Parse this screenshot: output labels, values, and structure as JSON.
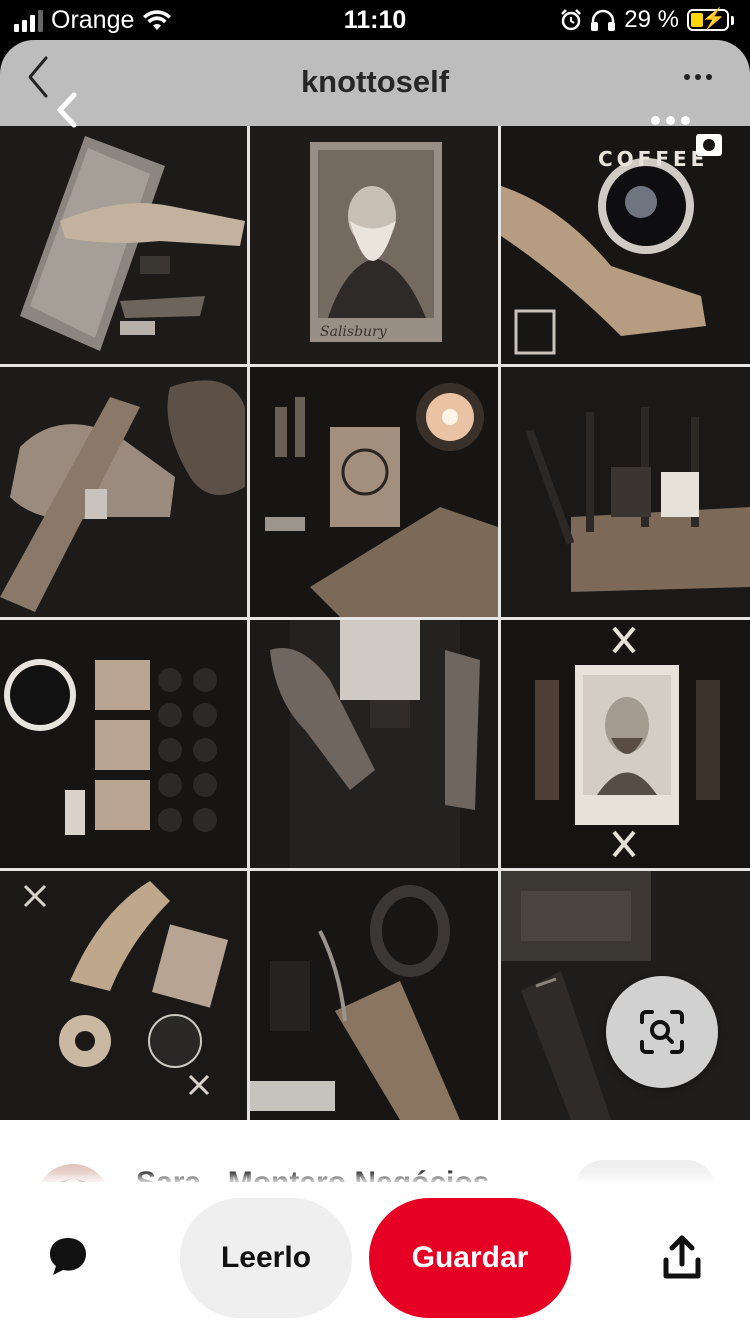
{
  "status_bar": {
    "carrier": "Orange",
    "time": "11:10",
    "battery_percent": "29 %",
    "icons": [
      "signal-icon",
      "wifi-icon",
      "alarm-icon",
      "headphones-icon",
      "battery-charging-icon"
    ]
  },
  "header": {
    "title": "knottoself",
    "back_icon": "chevron-left-icon",
    "more_icon": "more-horizontal-icon"
  },
  "pin_image": {
    "layout": "3x4 photo grid",
    "tiles": [
      {
        "text": "COFFEE"
      },
      {
        "text": "Salisbury"
      },
      {
        "text": ""
      }
    ]
  },
  "lens_icon": "visual-search-icon",
  "author": {
    "name": "Sara - Montero Negócios"
  },
  "actions": {
    "comment_icon": "comment-icon",
    "read_label": "Leerlo",
    "save_label": "Guardar",
    "share_icon": "share-icon"
  },
  "colors": {
    "save_red": "#e60023",
    "button_gray": "#efefef",
    "header_gray": "#bdbdbd"
  }
}
